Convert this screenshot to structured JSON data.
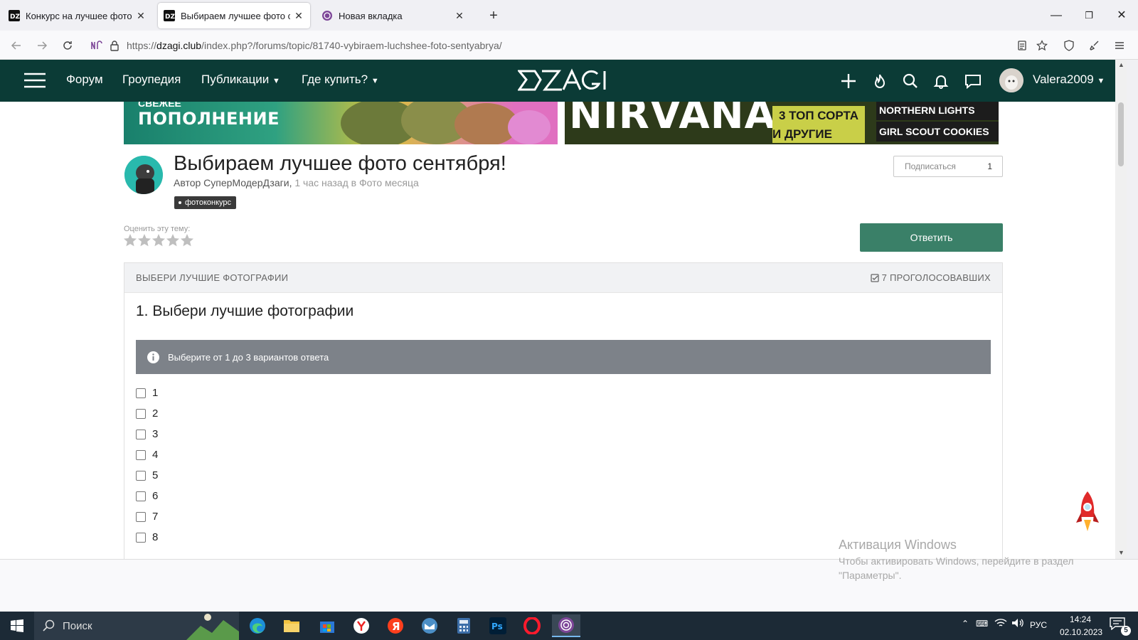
{
  "colors": {
    "site_header": "#0b3b36",
    "reply_button": "#3a8068",
    "info_bar": "#7d8289",
    "tag_bg": "#3a3a3a"
  },
  "tabs": [
    {
      "title": "Конкурс на лучшее фото сентября",
      "icon": "dzagi-favicon",
      "active": false
    },
    {
      "title": "Выбираем лучшее фото сентября",
      "icon": "dzagi-favicon",
      "active": true
    },
    {
      "title": "Новая вкладка",
      "icon": "tor-favicon",
      "active": false
    }
  ],
  "address": {
    "scheme": "https://",
    "host": "dzagi.club",
    "path": "/index.php?/forums/topic/81740-vybiraem-luchshee-foto-sentyabrya/"
  },
  "site": {
    "nav": {
      "forum": "Форум",
      "groupedia": "Гроупедия",
      "publications": "Публикации",
      "where_buy": "Где купить?"
    },
    "logo": "DZAGI",
    "username": "Valera2009"
  },
  "banners": {
    "left_text": "ПОПОЛНЕНИЕ",
    "left_top": "СВЕЖЕЕ",
    "right_brand": "NIRVANA",
    "right_badge1": "3 ТОП СОРТА",
    "right_badge2": "И ДРУГИЕ",
    "right_strain1": "NORTHERN LIGHTS",
    "right_strain2": "GIRL SCOUT COOKIES"
  },
  "topic": {
    "title": "Выбираем лучшее фото сентября!",
    "author_prefix": "Автор СуперМодерДзаги,",
    "time_ago": "1 час назад",
    "in_word": "в",
    "category": "Фото месяца",
    "tag": "фотоконкурс",
    "subscribe_label": "Подписаться",
    "subscribe_count": "1",
    "rate_label": "Оценить эту тему:",
    "rating_stars": 0,
    "reply_label": "Ответить"
  },
  "poll": {
    "header_title": "ВЫБЕРИ ЛУЧШИЕ ФОТОГРАФИИ",
    "voters": "7 ПРОГОЛОСОВАВШИХ",
    "question": "1. Выбери лучшие фотографии",
    "hint": "Выберите от 1 до 3 вариантов ответа",
    "options": [
      "1",
      "2",
      "3",
      "4",
      "5",
      "6",
      "7",
      "8"
    ]
  },
  "watermark": {
    "title": "Активация Windows",
    "line1": "Чтобы активировать Windows, перейдите в раздел",
    "line2": "\"Параметры\"."
  },
  "taskbar": {
    "search": "Поиск",
    "lang": "РУС",
    "time": "14:24",
    "date": "02.10.2023",
    "notifications": "5"
  }
}
